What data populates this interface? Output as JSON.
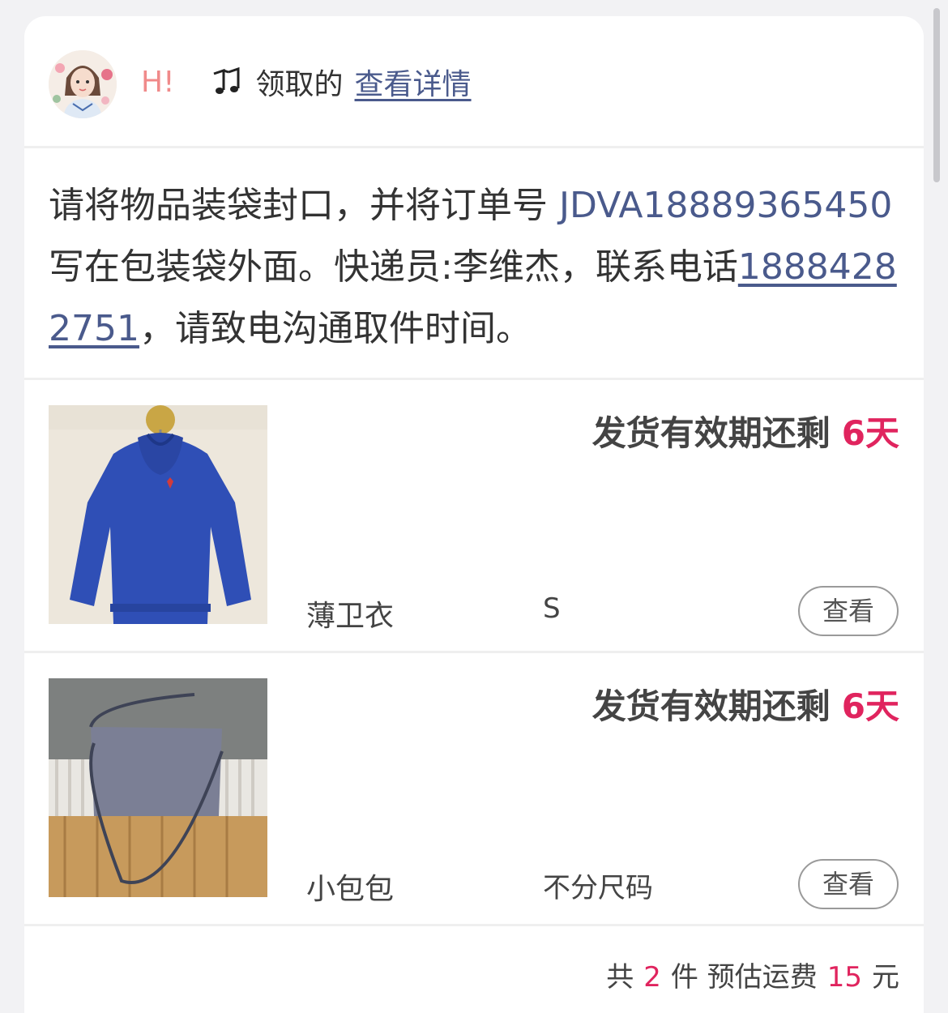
{
  "header": {
    "greeting": "H!",
    "received_by": "领取的",
    "detail_link": "查看详情"
  },
  "instructions": {
    "text_before": "请将物品装袋封口，并将订单号 ",
    "order_number": "JDVA18889365450",
    "text_middle": " 写在包装袋外面。快递员:李维杰，联系电话",
    "phone": "18884282751",
    "text_after": "，请致电沟通取件时间。"
  },
  "items": [
    {
      "deadline_label": "发货有效期还剩",
      "days_left": "6天",
      "name": "薄卫衣",
      "size": "S",
      "view_label": "查看",
      "thumb_icon": "blue-hoodie-photo"
    },
    {
      "deadline_label": "发货有效期还剩",
      "days_left": "6天",
      "name": "小包包",
      "size": "不分尺码",
      "view_label": "查看",
      "thumb_icon": "grey-bag-photo"
    }
  ],
  "footer": {
    "total_prefix": "共",
    "total_count": "2",
    "total_unit": "件",
    "fee_label": "预估运费",
    "fee_amount": "15",
    "fee_unit": "元"
  },
  "colors": {
    "link": "#4a5a8c",
    "accent": "#e0245e",
    "greeting": "#f08a8a",
    "page_bg": "#f2f2f4"
  }
}
